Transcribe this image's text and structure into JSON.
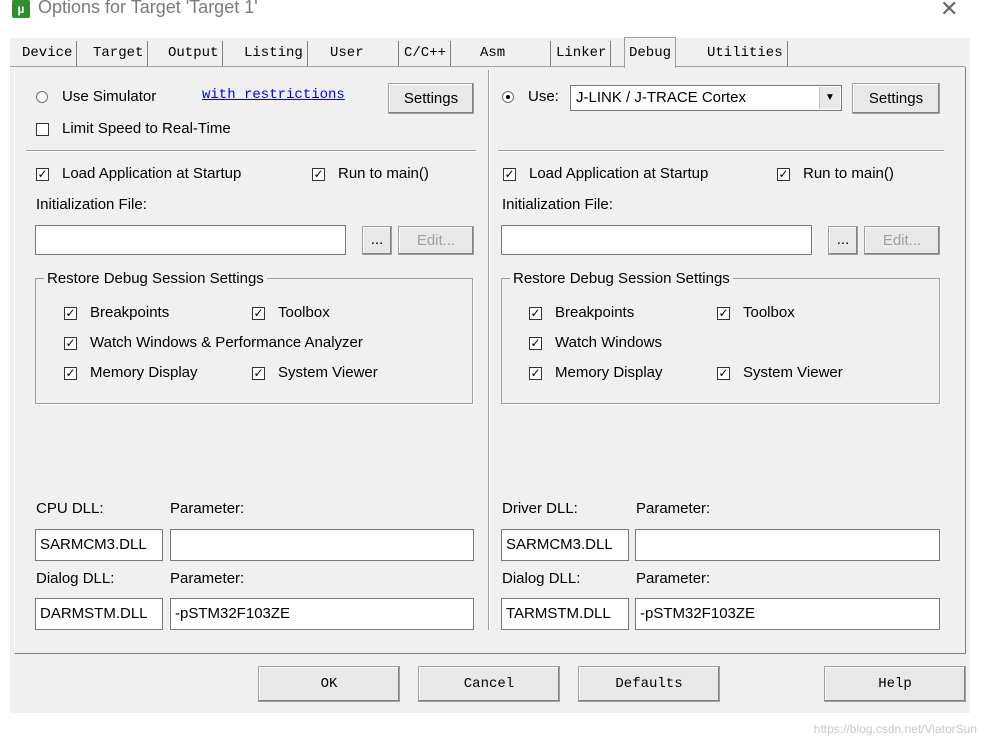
{
  "window": {
    "title": "Options for Target 'Target 1'",
    "icon": "uvision-icon",
    "close": "✕"
  },
  "tabs": [
    "Device",
    "Target",
    "Output",
    "Listing",
    "User",
    "C/C++",
    "Asm",
    "Linker",
    "Debug",
    "Utilities"
  ],
  "active_tab": "Debug",
  "left": {
    "use_simulator": "Use Simulator",
    "restrictions_link": "with restrictions",
    "settings": "Settings",
    "limit_speed": "Limit Speed to Real-Time",
    "load_app": "Load Application at Startup",
    "run_to_main": "Run to main()",
    "init_file_label": "Initialization File:",
    "init_file_value": "",
    "browse": "...",
    "edit": "Edit...",
    "restore_title": "Restore Debug Session Settings",
    "breakpoints": "Breakpoints",
    "toolbox": "Toolbox",
    "watch": "Watch Windows & Performance Analyzer",
    "memory": "Memory Display",
    "system_viewer": "System Viewer",
    "cpu_dll_label": "CPU DLL:",
    "param_label": "Parameter:",
    "cpu_dll": "SARMCM3.DLL",
    "cpu_param": "",
    "dialog_dll_label": "Dialog DLL:",
    "dialog_param_label": "Parameter:",
    "dialog_dll": "DARMSTM.DLL",
    "dialog_param": "-pSTM32F103ZE"
  },
  "right": {
    "use": "Use:",
    "driver_select": "J-LINK / J-TRACE Cortex",
    "settings": "Settings",
    "load_app": "Load Application at Startup",
    "run_to_main": "Run to main()",
    "init_file_label": "Initialization File:",
    "init_file_value": "",
    "browse": "...",
    "edit": "Edit...",
    "restore_title": "Restore Debug Session Settings",
    "breakpoints": "Breakpoints",
    "toolbox": "Toolbox",
    "watch": "Watch Windows",
    "memory": "Memory Display",
    "system_viewer": "System Viewer",
    "driver_dll_label": "Driver DLL:",
    "param_label": "Parameter:",
    "driver_dll": "SARMCM3.DLL",
    "driver_param": "",
    "dialog_dll_label": "Dialog DLL:",
    "dialog_param_label": "Parameter:",
    "dialog_dll": "TARMSTM.DLL",
    "dialog_param": "-pSTM32F103ZE"
  },
  "footer": {
    "ok": "OK",
    "cancel": "Cancel",
    "defaults": "Defaults",
    "help": "Help"
  },
  "watermark": "https://blog.csdn.net/ViatorSun",
  "colors": {
    "dialog_bg": "#f0f0f0",
    "link": "#0000ee",
    "icon_green": "#2f8f2f"
  }
}
